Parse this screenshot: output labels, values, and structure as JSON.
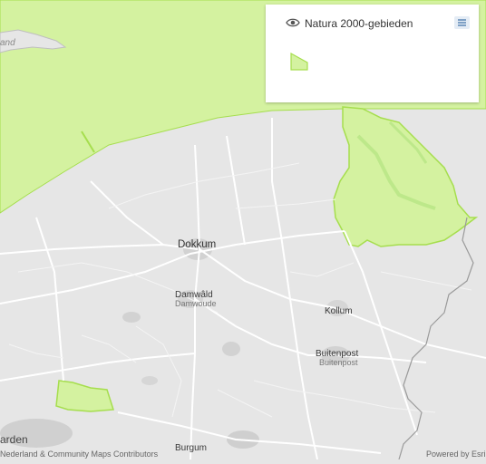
{
  "colors": {
    "land": "#e6e6e6",
    "natura_fill": "#d4f2a0",
    "natura_stroke": "#a6de4e",
    "road": "#ffffff",
    "border": "#999999",
    "urban": "#c9c9c9"
  },
  "map_labels": {
    "dokkum": "Dokkum",
    "damwald": "Damwâld",
    "damwoude": "Damwoude",
    "kollum": "Kollum",
    "buitenpost": "Buitenpost",
    "buitenpost_sub": "Buitenpost",
    "burgum": "Burgum",
    "leeuwarden_partial": "arden",
    "island_partial": "and"
  },
  "legend": {
    "eye_icon": "eye-icon",
    "layer_title": "Natura 2000-gebieden",
    "menu_icon": "list-icon"
  },
  "attribution": {
    "left": "Nederland & Community Maps Contributors",
    "right": "Powered by Esri"
  }
}
